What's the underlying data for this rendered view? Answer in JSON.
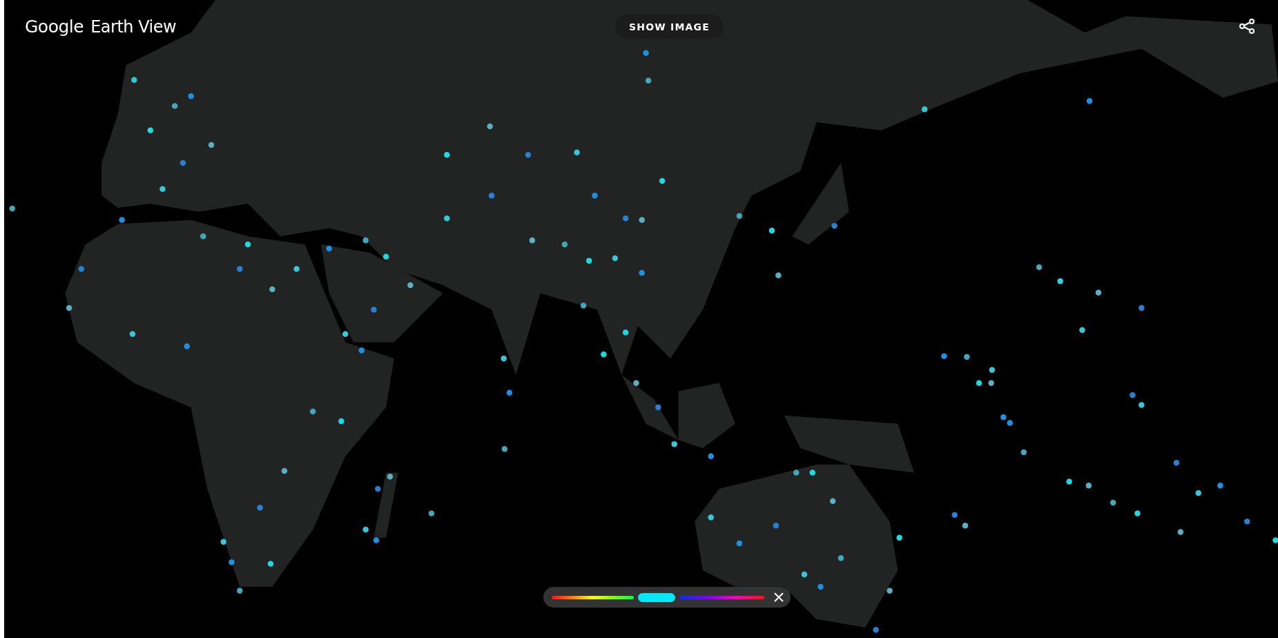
{
  "header": {
    "logo": "Google",
    "title": "Earth View",
    "button": "SHOW IMAGE"
  },
  "color_filter": {
    "level": 0.49
  }
}
